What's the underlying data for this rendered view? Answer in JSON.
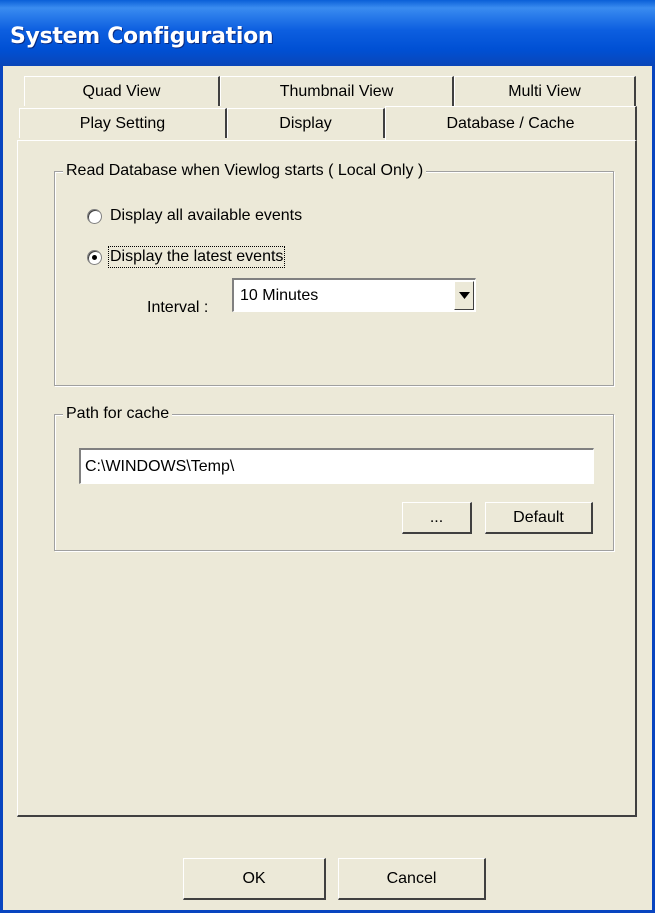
{
  "window": {
    "title": "System Configuration"
  },
  "tabs": {
    "row1": [
      "Quad View",
      "Thumbnail View",
      "Multi View"
    ],
    "row2": [
      "Play Setting",
      "Display",
      "Database / Cache"
    ],
    "active": "Database / Cache"
  },
  "read_db": {
    "legend": "Read Database when Viewlog starts ( Local Only )",
    "option_all": "Display all available events",
    "option_latest": "Display the latest events",
    "selected": "Display the latest events",
    "interval_label": "Interval :",
    "interval_value": "10 Minutes"
  },
  "cache": {
    "legend": "Path for cache",
    "path_value": "C:\\WINDOWS\\Temp\\",
    "browse_label": "...",
    "default_label": "Default"
  },
  "footer": {
    "ok_label": "OK",
    "cancel_label": "Cancel"
  }
}
